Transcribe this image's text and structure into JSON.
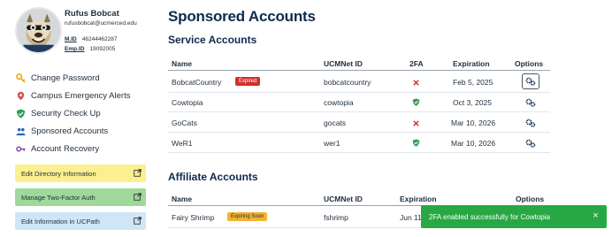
{
  "profile": {
    "name": "Rufus Bobcat",
    "email": "rufusbobcat@ucmerced.edu",
    "mid_label": "M.ID",
    "mid_value": "46244462287",
    "empid_label": "Emp.ID",
    "empid_value": "19092005"
  },
  "nav": [
    {
      "label": "Change Password",
      "icon": "key-icon",
      "color": "#e0a800"
    },
    {
      "label": "Campus Emergency Alerts",
      "icon": "alert-pin-icon",
      "color": "#d9534f"
    },
    {
      "label": "Security Check Up",
      "icon": "shield-check-icon",
      "color": "#2e9e4f"
    },
    {
      "label": "Sponsored Accounts",
      "icon": "users-icon",
      "color": "#2a6fbb"
    },
    {
      "label": "Account Recovery",
      "icon": "key-recovery-icon",
      "color": "#7b3fa0"
    }
  ],
  "quick_links": [
    {
      "label": "Edit Directory Information",
      "color": "#fbef8f"
    },
    {
      "label": "Manage Two-Factor Auth",
      "color": "#9fd99a"
    },
    {
      "label": "Edit Information in UCPath",
      "color": "#cfe6f7"
    }
  ],
  "page_title": "Sponsored Accounts",
  "service": {
    "title": "Service Accounts",
    "headers": {
      "name": "Name",
      "ucmnet": "UCMNet ID",
      "twofa": "2FA",
      "expiration": "Expiration",
      "options": "Options"
    },
    "rows": [
      {
        "name": "BobcatCountry",
        "badge": "Expired",
        "ucmnet": "bobcatcountry",
        "twofa": "no",
        "expiration": "Feb 5, 2025"
      },
      {
        "name": "Cowtopia",
        "badge": "",
        "ucmnet": "cowtopia",
        "twofa": "yes",
        "expiration": "Oct 3, 2025"
      },
      {
        "name": "GoCats",
        "badge": "",
        "ucmnet": "gocats",
        "twofa": "no",
        "expiration": "Mar 10, 2026"
      },
      {
        "name": "WeR1",
        "badge": "",
        "ucmnet": "wer1",
        "twofa": "yes",
        "expiration": "Mar 10, 2026"
      }
    ]
  },
  "affiliate": {
    "title": "Affiliate Accounts",
    "headers": {
      "name": "Name",
      "ucmnet": "UCMNet ID",
      "expiration": "Expiration",
      "options": "Options"
    },
    "rows": [
      {
        "name": "Fairy Shrimp",
        "badge": "Expiring Soon",
        "ucmnet": "fshrimp",
        "expiration": "Jun 11"
      }
    ]
  },
  "toast": {
    "message_prefix": "2FA enabled successfully for ",
    "message_name": "Cowtopia",
    "close": "×"
  },
  "colors": {
    "accent": "#0e2a4d",
    "expired": "#d32f2f",
    "expiring": "#f2b233",
    "success": "#27a844"
  }
}
